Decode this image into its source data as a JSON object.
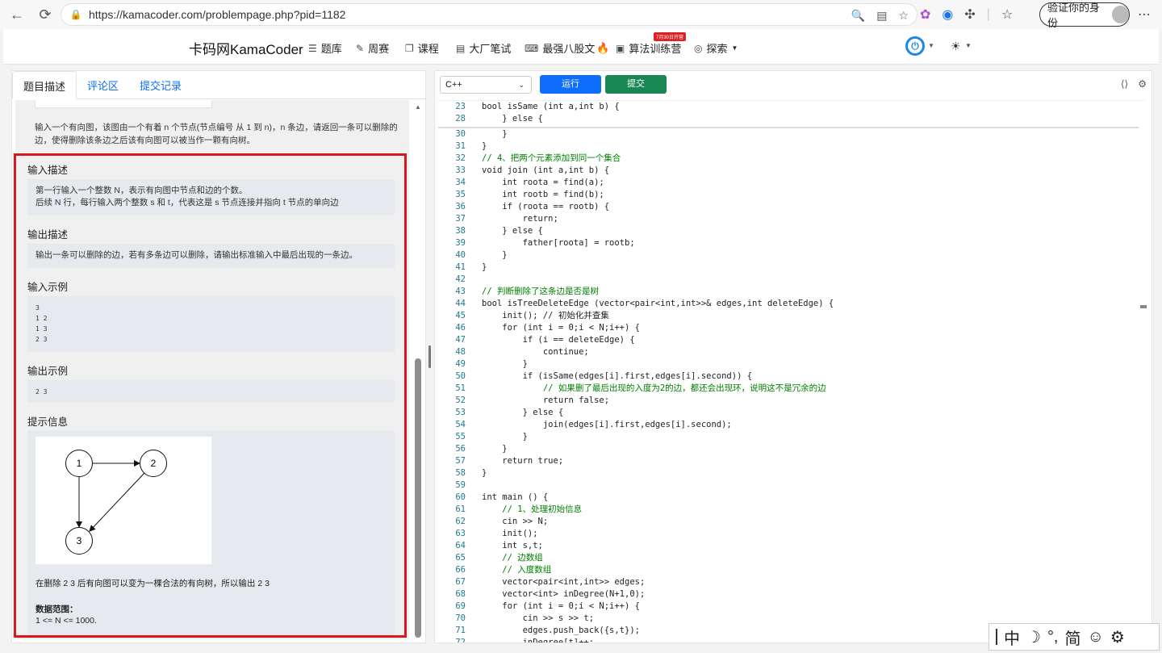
{
  "browser": {
    "url": "https://kamacoder.com/problempage.php?pid=1182",
    "verify_label": "验证你的身份"
  },
  "header": {
    "brand": "卡码网KamaCoder",
    "nav": [
      "题库",
      "周赛",
      "课程",
      "大厂笔试",
      "最强八股文",
      "算法训练营",
      "探索"
    ],
    "badge": "7月30日开营"
  },
  "left": {
    "tabs": [
      "题目描述",
      "评论区",
      "提交记录"
    ],
    "intro": "输入一个有向图，该图由一个有着 n 个节点(节点编号 从 1 到 n)，n 条边，请返回一条可以删除的边，使得删除该条边之后该有向图可以被当作一颗有向树。",
    "input_title": "输入描述",
    "input_line1": "第一行输入一个整数 N，表示有向图中节点和边的个数。",
    "input_line2": "后续 N 行，每行输入两个整数 s 和 t，代表这是 s 节点连接并指向 t 节点的单向边",
    "output_title": "输出描述",
    "output_text": "输出一条可以删除的边，若有多条边可以删除，请输出标准输入中最后出现的一条边。",
    "sample_in_title": "输入示例",
    "sample_in": [
      "3",
      "1 2",
      "1 3",
      "2 3"
    ],
    "sample_out_title": "输出示例",
    "sample_out": "2 3",
    "hint_title": "提示信息",
    "graph_nodes": [
      "1",
      "2",
      "3"
    ],
    "hint_text": "在删除 2 3 后有向图可以变为一棵合法的有向树，所以输出 2 3",
    "range_title": "数据范围：",
    "range_text": "1 <= N <= 1000."
  },
  "editor": {
    "language": "C++",
    "run_label": "运行",
    "submit_label": "提交",
    "lines": [
      {
        "n": "23",
        "t": "bool isSame (int a,int b) {"
      },
      {
        "n": "28",
        "t": "    } else {"
      },
      {
        "n": "30",
        "t": "    }"
      },
      {
        "n": "31",
        "t": "}"
      },
      {
        "n": "32",
        "t": "// 4、把两个元素添加到同一个集合"
      },
      {
        "n": "33",
        "t": "void join (int a,int b) {"
      },
      {
        "n": "34",
        "t": "    int roota = find(a);"
      },
      {
        "n": "35",
        "t": "    int rootb = find(b);"
      },
      {
        "n": "36",
        "t": "    if (roota == rootb) {"
      },
      {
        "n": "37",
        "t": "        return;"
      },
      {
        "n": "38",
        "t": "    } else {"
      },
      {
        "n": "39",
        "t": "        father[roota] = rootb;"
      },
      {
        "n": "40",
        "t": "    }"
      },
      {
        "n": "41",
        "t": "}"
      },
      {
        "n": "42",
        "t": ""
      },
      {
        "n": "43",
        "t": "// 判断删除了这条边是否是树"
      },
      {
        "n": "44",
        "t": "bool isTreeDeleteEdge (vector<pair<int,int>>& edges,int deleteEdge) {"
      },
      {
        "n": "45",
        "t": "    init(); // 初始化并查集"
      },
      {
        "n": "46",
        "t": "    for (int i = 0;i < N;i++) {"
      },
      {
        "n": "47",
        "t": "        if (i == deleteEdge) {"
      },
      {
        "n": "48",
        "t": "            continue;"
      },
      {
        "n": "49",
        "t": "        }"
      },
      {
        "n": "50",
        "t": "        if (isSame(edges[i].first,edges[i].second)) {"
      },
      {
        "n": "51",
        "t": "            // 如果删了最后出现的入度为2的边，都还会出现环，说明这不是冗余的边"
      },
      {
        "n": "52",
        "t": "            return false;"
      },
      {
        "n": "53",
        "t": "        } else {"
      },
      {
        "n": "54",
        "t": "            join(edges[i].first,edges[i].second);"
      },
      {
        "n": "55",
        "t": "        }"
      },
      {
        "n": "56",
        "t": "    }"
      },
      {
        "n": "57",
        "t": "    return true;"
      },
      {
        "n": "58",
        "t": "}"
      },
      {
        "n": "59",
        "t": ""
      },
      {
        "n": "60",
        "t": "int main () {"
      },
      {
        "n": "61",
        "t": "    // 1、处理初始信息"
      },
      {
        "n": "62",
        "t": "    cin >> N;"
      },
      {
        "n": "63",
        "t": "    init();"
      },
      {
        "n": "64",
        "t": "    int s,t;"
      },
      {
        "n": "65",
        "t": "    // 边数组"
      },
      {
        "n": "66",
        "t": "    // 入度数组"
      },
      {
        "n": "67",
        "t": "    vector<pair<int,int>> edges;"
      },
      {
        "n": "68",
        "t": "    vector<int> inDegree(N+1,0);"
      },
      {
        "n": "69",
        "t": "    for (int i = 0;i < N;i++) {"
      },
      {
        "n": "70",
        "t": "        cin >> s >> t;"
      },
      {
        "n": "71",
        "t": "        edges.push_back({s,t});"
      },
      {
        "n": "72",
        "t": "        inDegree[t]++;"
      }
    ]
  },
  "ime": [
    "中",
    "☽",
    "°,",
    "简",
    "☺",
    "⚙"
  ]
}
